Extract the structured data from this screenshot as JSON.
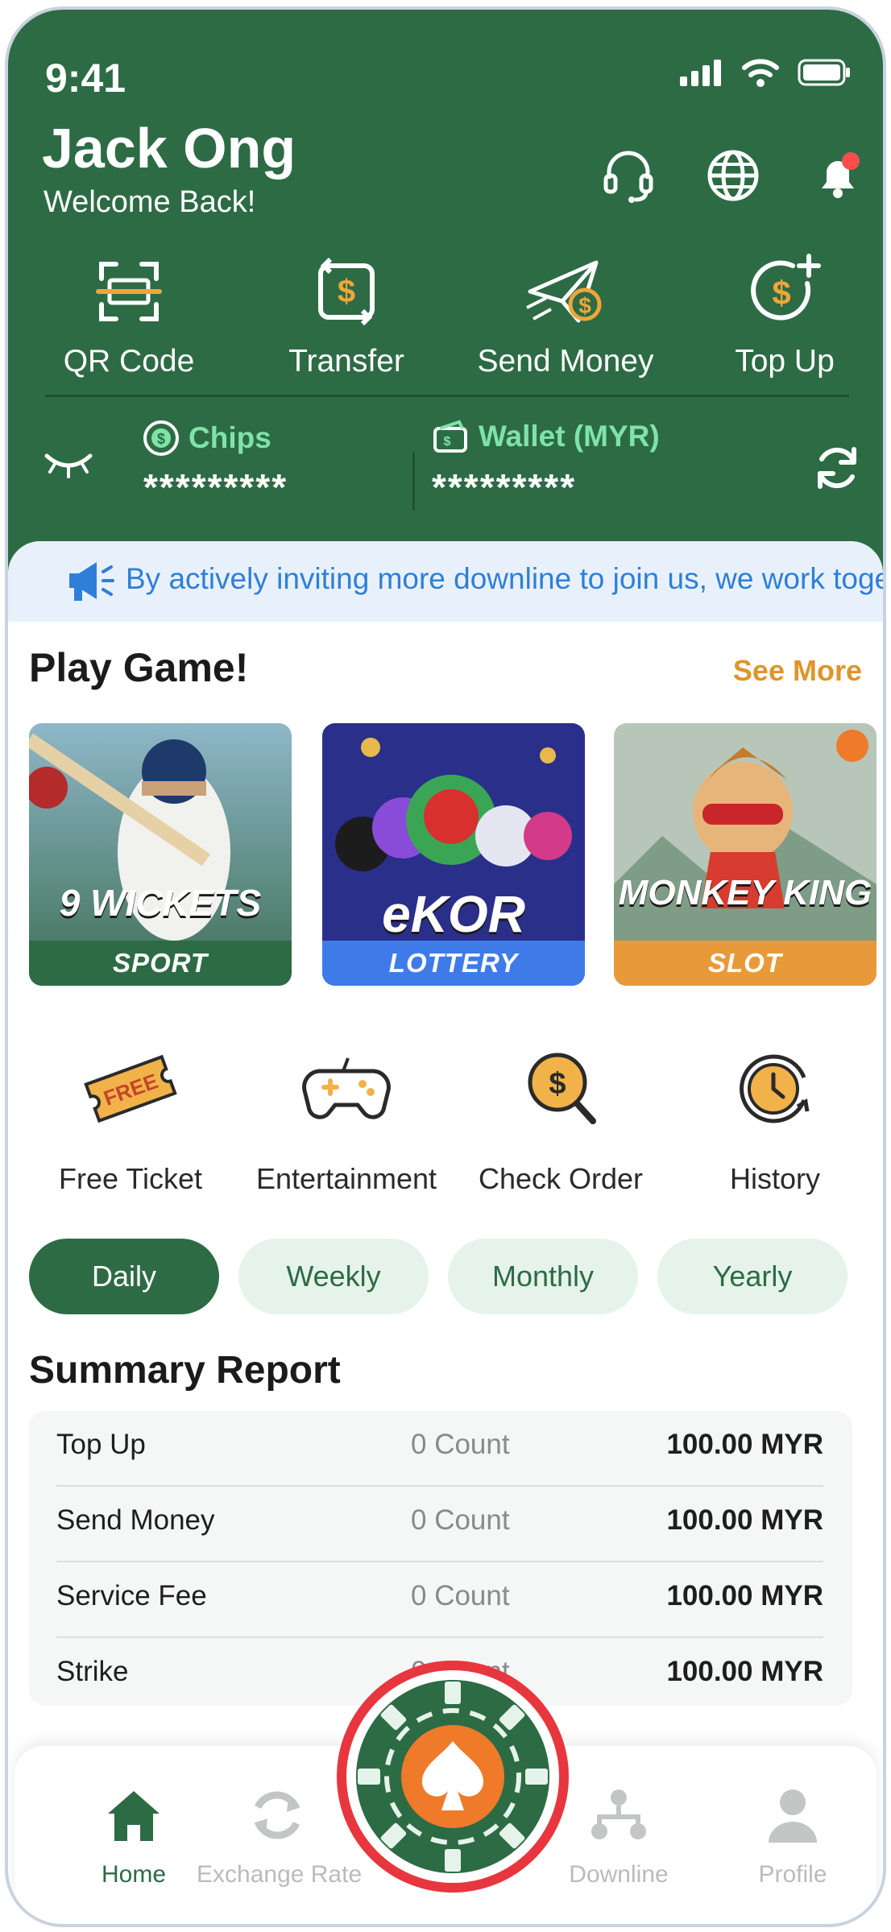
{
  "status_bar": {
    "time": "9:41"
  },
  "header": {
    "user_name": "Jack Ong",
    "welcome": "Welcome Back!",
    "icons": [
      "headset-icon",
      "globe-icon",
      "bell-icon"
    ]
  },
  "actions": [
    {
      "label": "QR Code",
      "icon": "qr-scan-icon"
    },
    {
      "label": "Transfer",
      "icon": "transfer-icon"
    },
    {
      "label": "Send Money",
      "icon": "send-money-icon"
    },
    {
      "label": "Top Up",
      "icon": "top-up-icon"
    }
  ],
  "balances": {
    "chips_label": "Chips",
    "chips_value": "*********",
    "wallet_label": "Wallet (MYR)",
    "wallet_value": "*********"
  },
  "announcement": "By actively inviting more downline to join us, we work togeth",
  "play_game": {
    "title": "Play Game!",
    "see_more": "See More",
    "games": [
      {
        "title": "9 WICKETS",
        "tag": "SPORT",
        "tag_color": "#2d6b45"
      },
      {
        "title": "eKOR",
        "tag": "LOTTERY",
        "tag_color": "#3f7be8"
      },
      {
        "title": "MONKEY KING",
        "tag": "SLOT",
        "tag_color": "#e89a3a"
      }
    ]
  },
  "quick_links": [
    {
      "label": "Free Ticket",
      "icon": "ticket-icon"
    },
    {
      "label": "Entertainment",
      "icon": "gamepad-icon"
    },
    {
      "label": "Check Order",
      "icon": "check-order-icon"
    },
    {
      "label": "History",
      "icon": "history-icon"
    }
  ],
  "periods": [
    {
      "label": "Daily",
      "active": true
    },
    {
      "label": "Weekly",
      "active": false
    },
    {
      "label": "Monthly",
      "active": false
    },
    {
      "label": "Yearly",
      "active": false
    }
  ],
  "summary": {
    "title": "Summary Report",
    "rows": [
      {
        "name": "Top Up",
        "count": "0 Count",
        "amount": "100.00 MYR"
      },
      {
        "name": "Send Money",
        "count": "0 Count",
        "amount": "100.00 MYR"
      },
      {
        "name": "Service Fee",
        "count": "0 Count",
        "amount": "100.00 MYR"
      },
      {
        "name": "Strike",
        "count": "0 Count",
        "amount": "100.00 MYR"
      }
    ]
  },
  "nav": [
    {
      "label": "Home",
      "icon": "home-icon",
      "active": true
    },
    {
      "label": "Exchange Rate",
      "icon": "exchange-icon",
      "active": false
    },
    {
      "label": "Downline",
      "icon": "downline-icon",
      "active": false
    },
    {
      "label": "Profile",
      "icon": "profile-icon",
      "active": false
    }
  ],
  "colors": {
    "primary": "#2d6b45",
    "accent": "#e89a3a",
    "highlight_ring": "#e8363e"
  }
}
